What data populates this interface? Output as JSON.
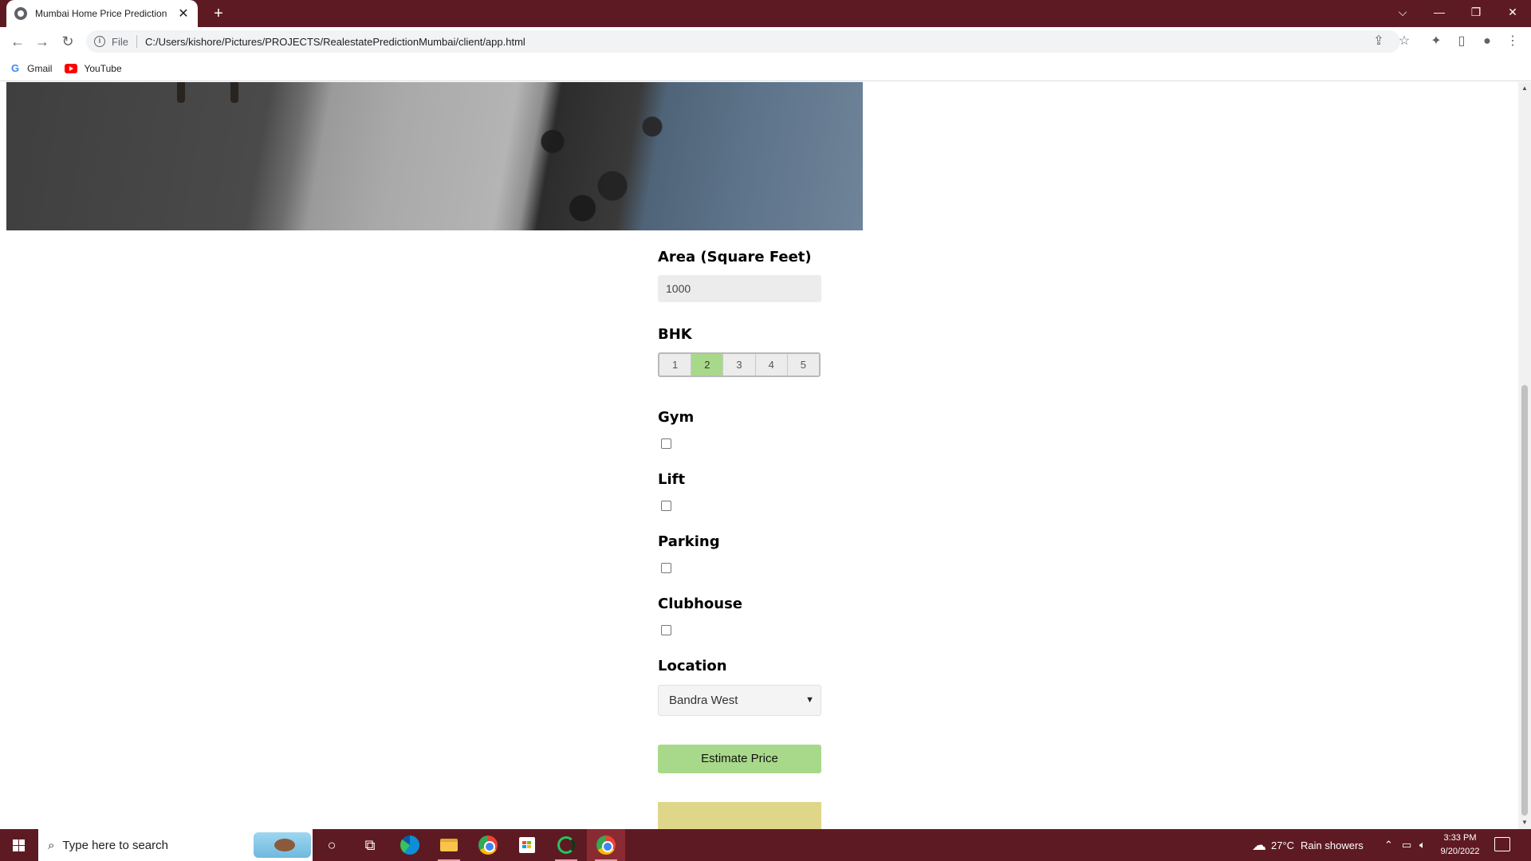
{
  "browser": {
    "tab_title": "Mumbai Home Price Prediction",
    "tab_close": "✕",
    "new_tab": "+",
    "address_prefix": "File",
    "address_url": "C:/Users/kishore/Pictures/PROJECTS/RealestatePredictionMumbai/client/app.html",
    "bookmarks": [
      {
        "label": "Gmail",
        "icon": "google-icon"
      },
      {
        "label": "YouTube",
        "icon": "youtube-icon"
      }
    ]
  },
  "form": {
    "area_label": "Area (Square Feet)",
    "area_value": "1000",
    "bhk_label": "BHK",
    "bhk_options": [
      "1",
      "2",
      "3",
      "4",
      "5"
    ],
    "bhk_selected": "2",
    "gym_label": "Gym",
    "lift_label": "Lift",
    "parking_label": "Parking",
    "clubhouse_label": "Clubhouse",
    "location_label": "Location",
    "location_value": "Bandra West",
    "estimate_button": "Estimate Price",
    "accent_color": "#a8d98a",
    "result_color": "#ded78a"
  },
  "taskbar": {
    "search_placeholder": "Type here to search",
    "weather_temp": "27°C",
    "weather_text": "Rain showers",
    "time": "3:33 PM",
    "date": "9/20/2022",
    "apps": [
      "cortana-icon",
      "task-view-icon",
      "edge-icon",
      "file-explorer-icon",
      "chrome-icon",
      "store-icon",
      "ring-app-icon",
      "chrome-active-icon"
    ]
  }
}
